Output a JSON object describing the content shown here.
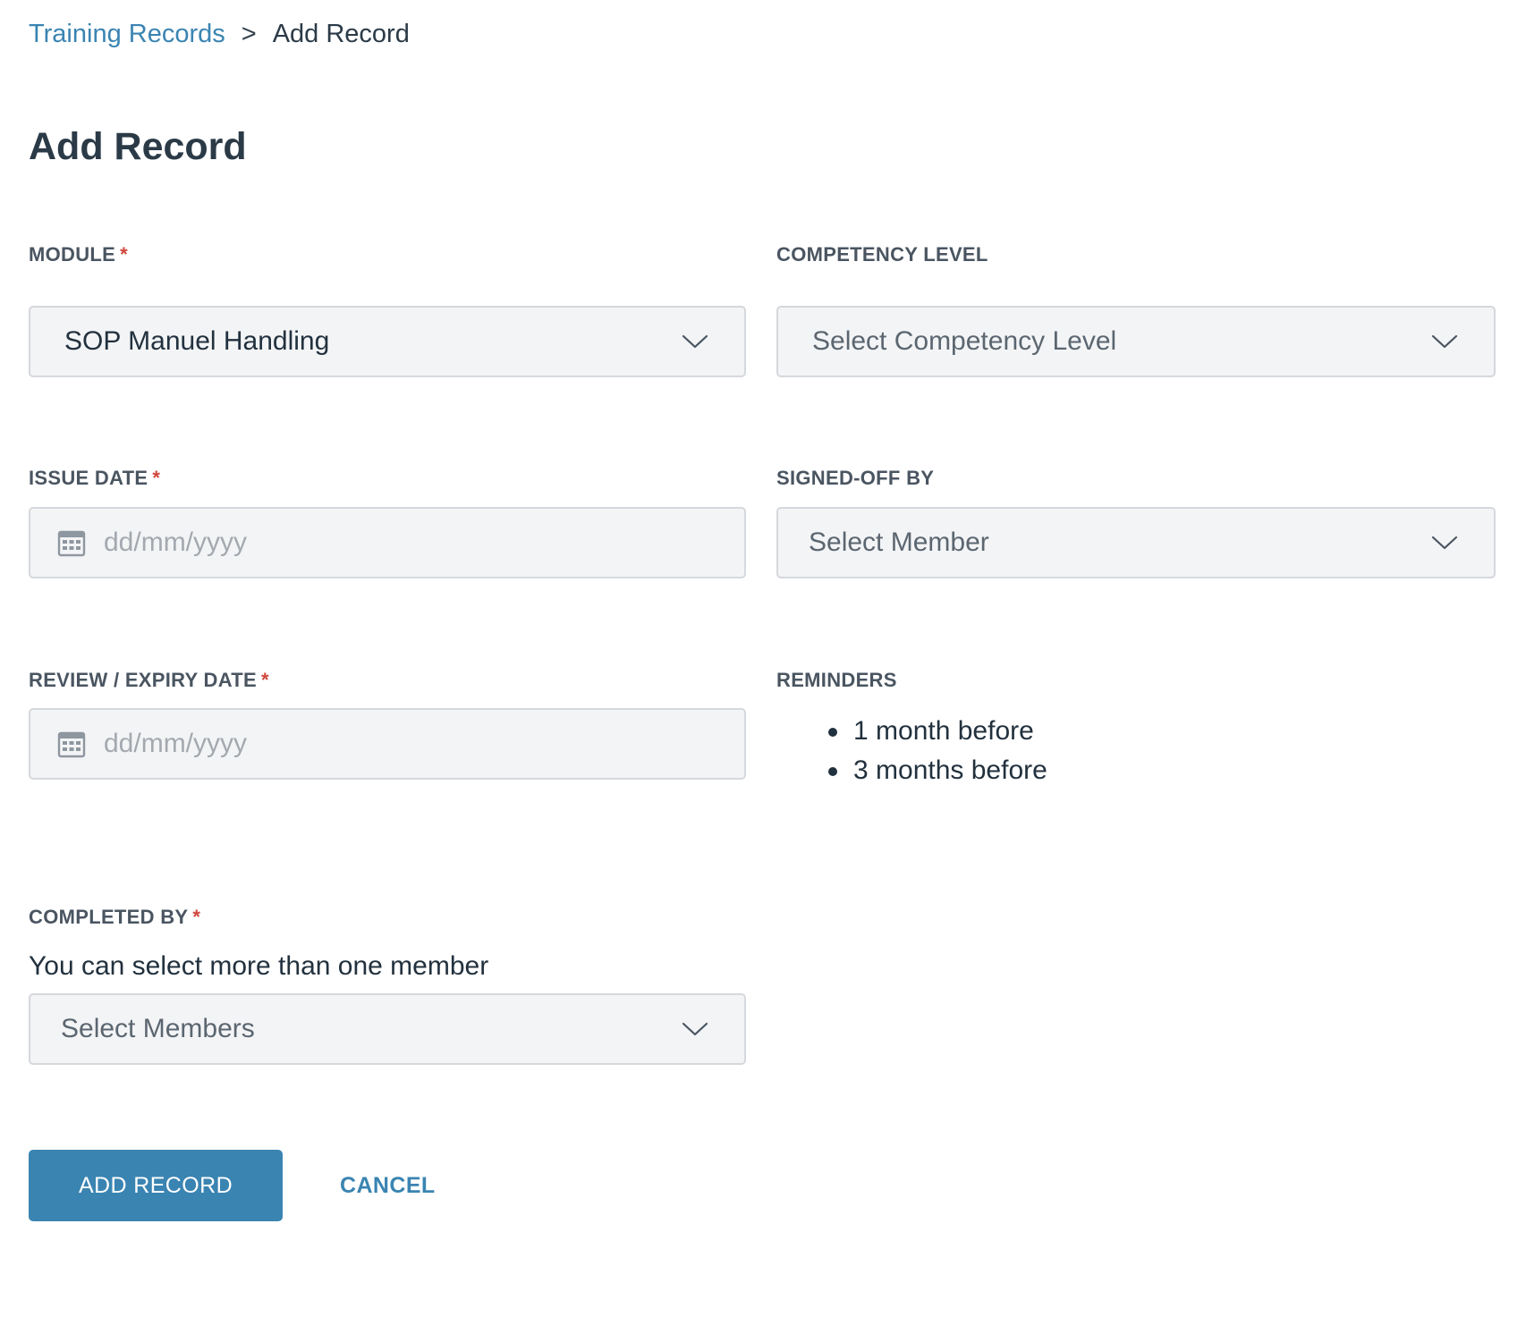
{
  "breadcrumb": {
    "parent": "Training Records",
    "separator": ">",
    "current": "Add Record"
  },
  "page_title": "Add Record",
  "form": {
    "module": {
      "label": "MODULE",
      "required_mark": "*",
      "value": "SOP Manuel Handling",
      "icon": "chevron-down-icon"
    },
    "competency_level": {
      "label": "COMPETENCY LEVEL",
      "placeholder": "Select Competency Level",
      "icon": "chevron-down-icon"
    },
    "issue_date": {
      "label": "ISSUE DATE",
      "required_mark": "*",
      "placeholder": "dd/mm/yyyy",
      "icon": "calendar-icon"
    },
    "signed_off_by": {
      "label": "SIGNED-OFF BY",
      "placeholder": "Select Member",
      "icon": "chevron-down-icon"
    },
    "review_expiry_date": {
      "label": "REVIEW / EXPIRY DATE",
      "required_mark": "*",
      "placeholder": "dd/mm/yyyy",
      "icon": "calendar-icon"
    },
    "reminders": {
      "label": "REMINDERS",
      "items": [
        "1 month before",
        "3 months before"
      ]
    },
    "completed_by": {
      "label": "COMPLETED BY",
      "required_mark": "*",
      "helper_text": "You can select more than one member",
      "placeholder": "Select Members",
      "icon": "chevron-down-icon"
    }
  },
  "actions": {
    "submit_label": "ADD RECORD",
    "cancel_label": "CANCEL"
  },
  "colors": {
    "accent": "#3a84b2",
    "required": "#d0453b",
    "text": "#2b3a47",
    "input_background": "#f3f4f6",
    "input_border": "#d5d8dc"
  }
}
